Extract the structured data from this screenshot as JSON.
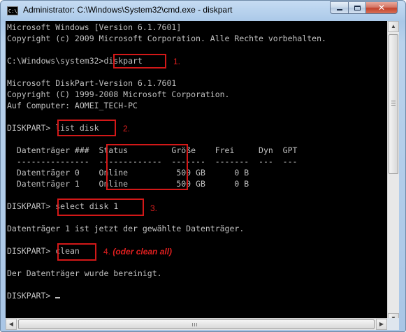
{
  "window": {
    "title": "Administrator: C:\\Windows\\System32\\cmd.exe - diskpart",
    "icon_text": "C:\\",
    "controls": {
      "minimize": "minimize-icon",
      "maximize": "maximize-icon",
      "close": "close-icon",
      "close_glyph": "✕"
    }
  },
  "console": {
    "lines": [
      "Microsoft Windows [Version 6.1.7601]",
      "Copyright (c) 2009 Microsoft Corporation. Alle Rechte vorbehalten.",
      "",
      "C:\\Windows\\system32>diskpart",
      "",
      "Microsoft DiskPart-Version 6.1.7601",
      "Copyright (C) 1999-2008 Microsoft Corporation.",
      "Auf Computer: AOMEI_TECH-PC",
      "",
      "DISKPART> list disk",
      "",
      "  Datenträger ###  Status         Größe    Frei     Dyn  GPT",
      "  ---------------  -------------  -------  -------  ---  ---",
      "  Datenträger 0    Online          500 GB      0 B",
      "  Datenträger 1    Online          500 GB      0 B",
      "",
      "DISKPART> select disk 1",
      "",
      "Datenträger 1 ist jetzt der gewählte Datenträger.",
      "",
      "DISKPART> clean",
      "",
      "Der Datenträger wurde bereinigt.",
      "",
      "DISKPART> "
    ]
  },
  "annotations": {
    "step1": "1.",
    "step2": "2.",
    "step3": "3.",
    "step4_number": "4.",
    "step4_note": "(oder clean all)",
    "color": "#d31818"
  },
  "scrollbars": {
    "up_arrow": "▲",
    "down_arrow": "▼",
    "left_arrow": "◀",
    "right_arrow": "▶"
  }
}
